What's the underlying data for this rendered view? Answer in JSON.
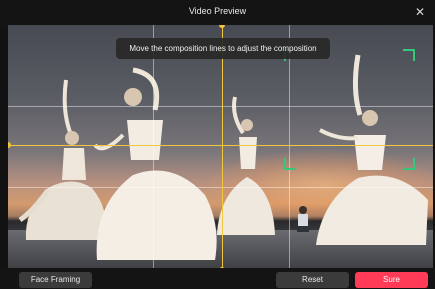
{
  "window": {
    "title": "Video Preview",
    "close_icon": "close-icon"
  },
  "preview": {
    "tooltip": "Move the composition lines to adjust the composition",
    "guide_color": "#f2c73b",
    "face_box_color": "#35c77a"
  },
  "footer": {
    "face_framing_label": "Face Framing",
    "reset_label": "Reset",
    "sure_label": "Sure",
    "sure_color": "#ff3b57"
  }
}
